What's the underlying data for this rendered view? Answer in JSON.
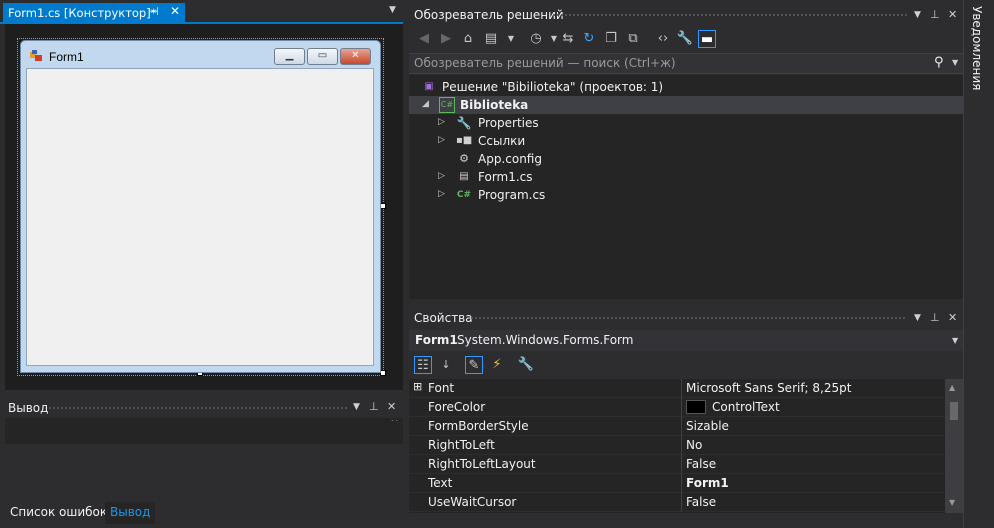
{
  "document": {
    "tab_label": "Form1.cs [Конструктор]*",
    "form_title": "Form1"
  },
  "output_panel": {
    "title": "Вывод",
    "bottom_tabs": [
      "Список ошибок",
      "Вывод"
    ]
  },
  "solution_explorer": {
    "title": "Обозреватель решений",
    "search_placeholder": "Обозреватель решений — поиск (Ctrl+ж)",
    "tree": [
      {
        "label": "Решение \"Bibilioteka\"  (проектов: 1)",
        "icon": "solution-icon"
      },
      {
        "label": "Biblioteka",
        "icon": "csharp-project-icon"
      },
      {
        "label": "Properties",
        "icon": "wrench-icon"
      },
      {
        "label": "Ссылки",
        "icon": "references-icon"
      },
      {
        "label": "App.config",
        "icon": "config-file-icon"
      },
      {
        "label": "Form1.cs",
        "icon": "form-file-icon"
      },
      {
        "label": "Program.cs",
        "icon": "csharp-file-icon"
      }
    ]
  },
  "properties": {
    "title": "Свойства",
    "object_name": "Form1",
    "object_type": "System.Windows.Forms.Form",
    "rows": [
      {
        "name": "Font",
        "value": "Microsoft Sans Serif; 8,25pt"
      },
      {
        "name": "ForeColor",
        "value": "ControlText"
      },
      {
        "name": "FormBorderStyle",
        "value": "Sizable"
      },
      {
        "name": "RightToLeft",
        "value": "No"
      },
      {
        "name": "RightToLeftLayout",
        "value": "False"
      },
      {
        "name": "Text",
        "value": "Form1"
      },
      {
        "name": "UseWaitCursor",
        "value": "False"
      }
    ]
  },
  "notifications": {
    "label": "Уведомления"
  },
  "colors": {
    "accent": "#007acc",
    "background": "#2d2d30",
    "panel": "#252526"
  }
}
